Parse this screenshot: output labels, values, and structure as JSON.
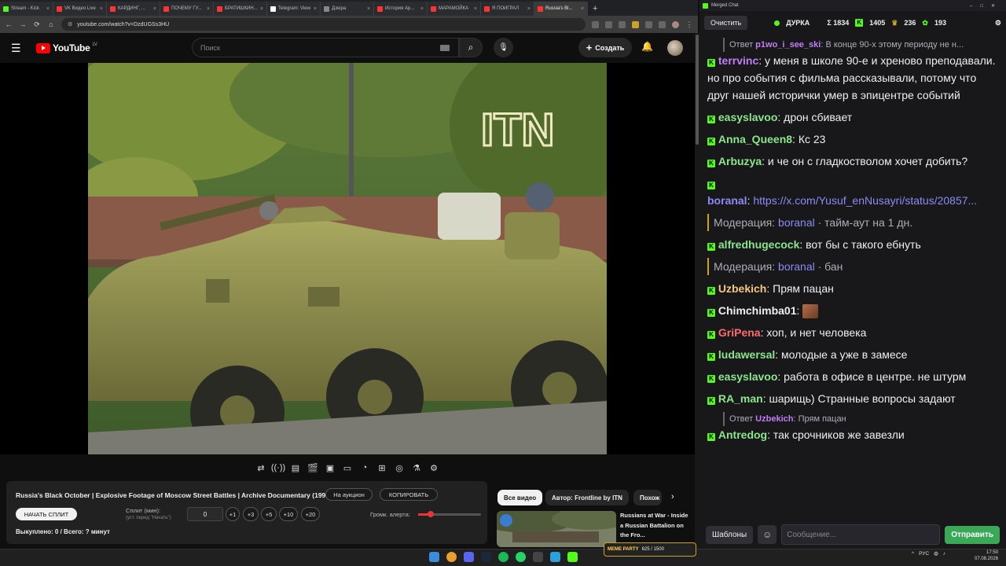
{
  "browser": {
    "tabs": [
      {
        "label": "Stream - Kick",
        "color": "#53fc18"
      },
      {
        "label": "VK Видео Live",
        "color": "#ff3333"
      },
      {
        "label": "КАРДИНГ, ...",
        "color": "#ff3333"
      },
      {
        "label": "ПОЧЕМУ ГУ...",
        "color": "#ff3333"
      },
      {
        "label": "БРАТИШКИН...",
        "color": "#ff3333"
      },
      {
        "label": "Telegram: View",
        "color": "#ffffff"
      },
      {
        "label": "Дзюра",
        "color": "#888888"
      },
      {
        "label": "История Ар...",
        "color": "#ff3333"
      },
      {
        "label": "МАРАМОЙКА",
        "color": "#ff3333"
      },
      {
        "label": "Я ПОИГРАЛ",
        "color": "#ff3333"
      },
      {
        "label": "Russia's Bl...",
        "color": "#ff3333"
      }
    ],
    "url": "youtube.com/watch?v=DzdUGSs3HU"
  },
  "youtube": {
    "logo_text": "YouTube",
    "logo_region": "LV",
    "search_placeholder": "Поиск",
    "create_label": "Создать"
  },
  "video": {
    "watermark": "ITN",
    "title": "Russia's Black October | Explosive Footage of Moscow Street Battles | Archive Documentary (1993)"
  },
  "controls": [
    "loop-icon",
    "broadcast-icon",
    "subtitles-icon",
    "clapper-icon",
    "pip-icon",
    "theater-icon",
    "speed-icon",
    "add-icon",
    "screenshot-icon",
    "lab-icon",
    "settings-icon"
  ],
  "info": {
    "auction_label": "На аукцион",
    "copy_label": "КОПИРОВАТЬ",
    "start_split_label": "НАЧАТЬ СПЛИТ",
    "split_label": "Сплит (мин):",
    "split_hint": "(уст. перед \"Начать\")",
    "split_value": "0",
    "increments": [
      "+1",
      "+3",
      "+5",
      "+10",
      "+20"
    ],
    "volume_label": "Громк. алерта:",
    "volume_level": 0.2,
    "bought": "Выкуплено: 0 / Всего: ? минут"
  },
  "related": {
    "chips": [
      "Все видео",
      "Автор: Frontline by ITN",
      "Похож"
    ],
    "title": "Russians at War - Inside a Russian Battalion on the Fro..."
  },
  "chat": {
    "window_title": "Merged Chat",
    "clear_label": "Очистить",
    "channel": "ДУРКА",
    "total": "Σ 1834",
    "kick_count": "1405",
    "vk_count": "236",
    "other_count": "193",
    "messages": [
      {
        "type": "reply",
        "prefix": "Ответ",
        "user": "p1wo_i_see_ski",
        "text": "В конце 90-х этому периоду не н..."
      },
      {
        "type": "msg",
        "user": "terrvinc",
        "color": "#bf7ff5",
        "text": "у меня в школе 90-е и хреново преподавали. но про события с фильма рассказывали, потому что друг нашей исторички умер в эпицентре событий"
      },
      {
        "type": "msg",
        "user": "easyslavoo",
        "color": "#8be68b",
        "text": "дрон сбивает"
      },
      {
        "type": "msg",
        "user": "Anna_Queen8",
        "color": "#8be68b",
        "text": "Кс 23"
      },
      {
        "type": "msg",
        "user": "Arbuzya",
        "color": "#8be68b",
        "text": "и че он с гладкостволом хочет добить?"
      },
      {
        "type": "link",
        "user": "boranal",
        "color": "#8b8bf5",
        "text": "https://x.com/Yusuf_enNusayri/status/20857..."
      },
      {
        "type": "mod",
        "label": "Модерация:",
        "user": "boranal",
        "text": "· тайм-аут на 1 дн."
      },
      {
        "type": "msg",
        "user": "alfredhugecock",
        "color": "#8be68b",
        "text": "вот бы с такого ебнуть"
      },
      {
        "type": "mod",
        "label": "Модерация:",
        "user": "boranal",
        "text": "· бан"
      },
      {
        "type": "msg",
        "user": "Uzbekich",
        "color": "#f5c77f",
        "text": "Прям пацан"
      },
      {
        "type": "emote",
        "user": "Chimchimba01",
        "color": "#efeff1",
        "text": ""
      },
      {
        "type": "msg",
        "user": "GriPena",
        "color": "#ff6b6b",
        "text": "хоп, и нет человека"
      },
      {
        "type": "msg",
        "user": "ludawersal",
        "color": "#8be68b",
        "text": "молодые а уже в замесе"
      },
      {
        "type": "msg",
        "user": "easyslavoo",
        "color": "#8be68b",
        "text": "работа в офисе в центре. не штурм"
      },
      {
        "type": "msg",
        "user": "RA_man",
        "color": "#8be68b",
        "text": "шарищь) Странные вопросы задают"
      },
      {
        "type": "reply",
        "prefix": "Ответ",
        "user": "Uzbekich",
        "text": "Прям пацан"
      },
      {
        "type": "msg",
        "user": "Antredog",
        "color": "#8be68b",
        "text": "так срочников же завезли"
      }
    ],
    "templates_label": "Шаблоны",
    "input_placeholder": "Сообщение...",
    "send_label": "Отправить"
  },
  "taskbar": {
    "party_label": "MEME PARTY",
    "party_count": "625 / 1500",
    "lang": "РУС",
    "time": "17:50",
    "date": "07.08.2026"
  }
}
